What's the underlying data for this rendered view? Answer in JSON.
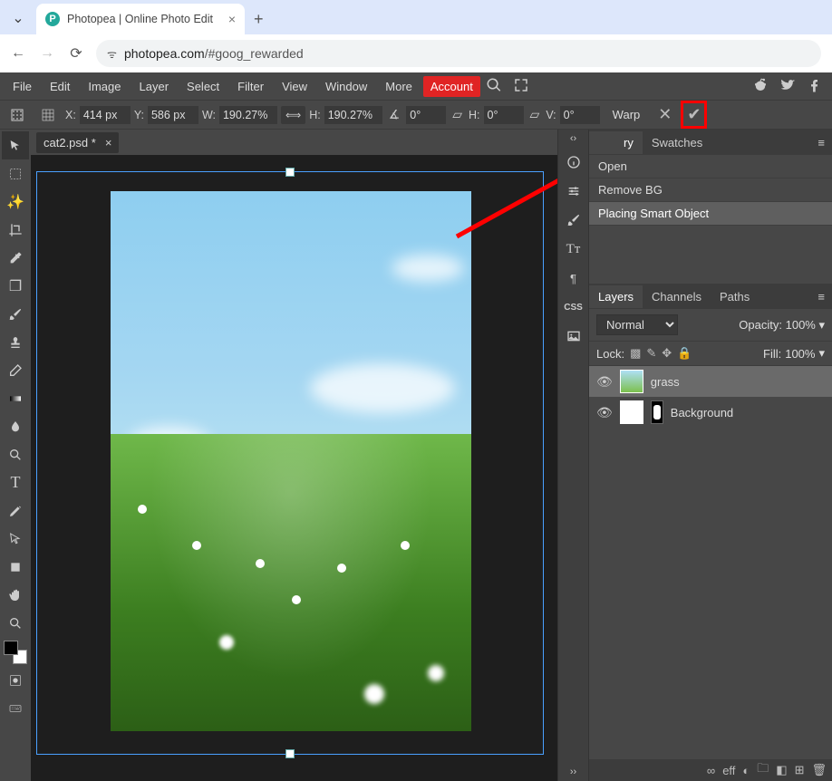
{
  "browser": {
    "tab_title": "Photopea | Online Photo Edit",
    "url_prefix": "photopea.com",
    "url_suffix": "/#goog_rewarded"
  },
  "menubar": {
    "items": [
      "File",
      "Edit",
      "Image",
      "Layer",
      "Select",
      "Filter",
      "View",
      "Window",
      "More"
    ],
    "account": "Account"
  },
  "options": {
    "x_label": "X:",
    "x_value": "414 px",
    "y_label": "Y:",
    "y_value": "586 px",
    "w_label": "W:",
    "w_value": "190.27%",
    "h_label": "H:",
    "h_value": "190.27%",
    "rot_value": "0°",
    "skewh_label": "H:",
    "skewh_value": "0°",
    "skewv_label": "V:",
    "skewv_value": "0°",
    "warp": "Warp"
  },
  "document": {
    "tab": "cat2.psd *"
  },
  "history": {
    "tabs": {
      "history_partial": "ry",
      "swatches": "Swatches"
    },
    "items": [
      "Open",
      "Remove BG",
      "Placing Smart Object"
    ]
  },
  "layers_panel": {
    "tabs": [
      "Layers",
      "Channels",
      "Paths"
    ],
    "blend": "Normal",
    "opacity_label": "Opacity:",
    "opacity_value": "100%",
    "lock_label": "Lock:",
    "fill_label": "Fill:",
    "fill_value": "100%",
    "layers": [
      {
        "name": "grass"
      },
      {
        "name": "Background"
      }
    ]
  },
  "bottom": {
    "eff": "eff"
  }
}
